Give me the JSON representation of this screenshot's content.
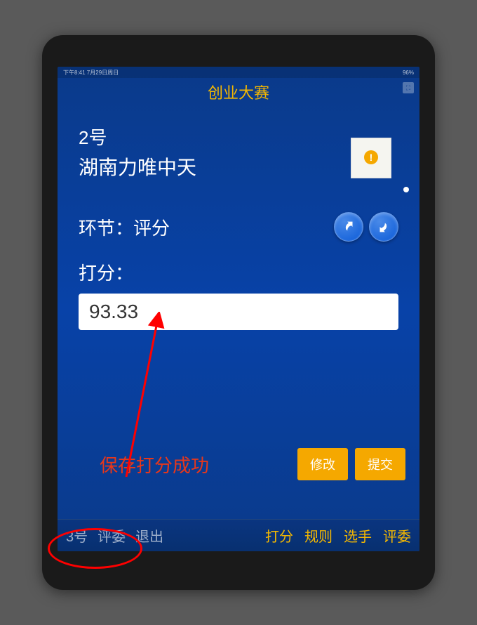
{
  "status_bar": {
    "left": "下午8:41  7月29日周日",
    "right": "96%"
  },
  "header": {
    "title": "创业大赛"
  },
  "contestant": {
    "number": "2号",
    "name": "湖南力唯中天"
  },
  "section": {
    "label": "环节：",
    "value": "评分"
  },
  "score": {
    "label": "打分：",
    "value": "93.33"
  },
  "status_message": "保存打分成功",
  "actions": {
    "modify": "修改",
    "submit": "提交"
  },
  "footer": {
    "judge_number": "3号",
    "judge_label": "评委",
    "exit": "退出",
    "tabs": {
      "score": "打分",
      "rules": "规则",
      "contestants": "选手",
      "judges": "评委"
    }
  }
}
